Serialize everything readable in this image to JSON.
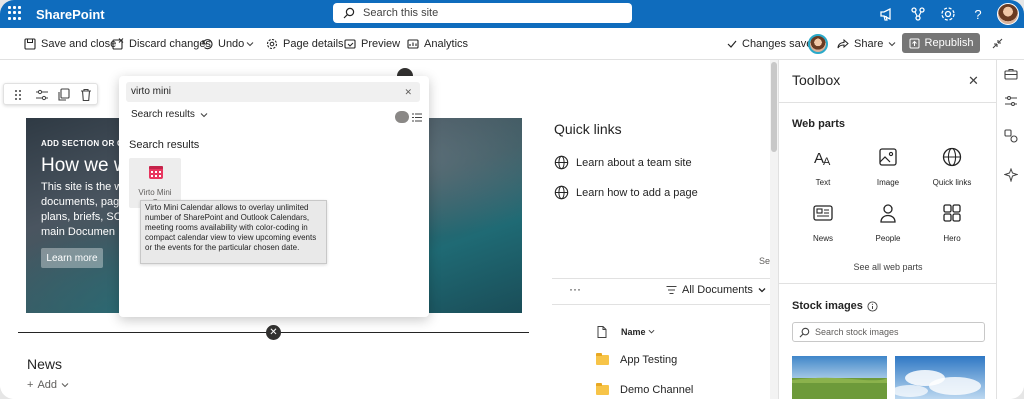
{
  "suite_bar": {
    "brand": "SharePoint",
    "search_placeholder": "Search this site"
  },
  "command_bar": {
    "save_close": "Save and close",
    "discard": "Discard changes",
    "undo": "Undo",
    "page_details": "Page details",
    "preview": "Preview",
    "analytics": "Analytics",
    "status": "Changes saved",
    "share": "Share",
    "republish": "Republish"
  },
  "hero": {
    "add_label": "ADD SECTION OR CAT",
    "title": "How we w",
    "body": "This site is the w documents, pag plans, briefs, SO main Documen",
    "button": "Learn more"
  },
  "search_flyout": {
    "query": "virto mini",
    "filter": "Search results",
    "heading": "Search results",
    "result": {
      "line1": "Virto Mini",
      "line2": "C"
    },
    "tooltip": "Virto Mini Calendar allows to overlay unlimited number of SharePoint and Outlook Calendars, meeting rooms availability with color-coding in compact calendar view to view upcoming events or the events for the particular chosen date."
  },
  "news": {
    "title": "News",
    "add": "Add"
  },
  "quick_links": {
    "title": "Quick links",
    "items": [
      {
        "label": "Learn about a team site"
      },
      {
        "label": "Learn how to add a page"
      }
    ],
    "see_fragment": "Se"
  },
  "documents": {
    "more": "···",
    "view": "All Documents",
    "column_name": "Name",
    "rows": [
      {
        "name": "App Testing"
      },
      {
        "name": "Demo Channel"
      }
    ]
  },
  "toolbox": {
    "title": "Toolbox",
    "web_parts_heading": "Web parts",
    "web_parts": [
      {
        "label": "Text",
        "icon": "text-icon"
      },
      {
        "label": "Image",
        "icon": "image-icon"
      },
      {
        "label": "Quick links",
        "icon": "globe-icon"
      },
      {
        "label": "News",
        "icon": "news-icon"
      },
      {
        "label": "People",
        "icon": "person-icon"
      },
      {
        "label": "Hero",
        "icon": "hero-grid-icon"
      }
    ],
    "see_all": "See all web parts",
    "stock_heading": "Stock images",
    "stock_search_placeholder": "Search stock images"
  },
  "colors": {
    "suite_bar": "#0f6cbd",
    "republish_bg": "#767676",
    "calendar_accent": "#e8365f"
  }
}
